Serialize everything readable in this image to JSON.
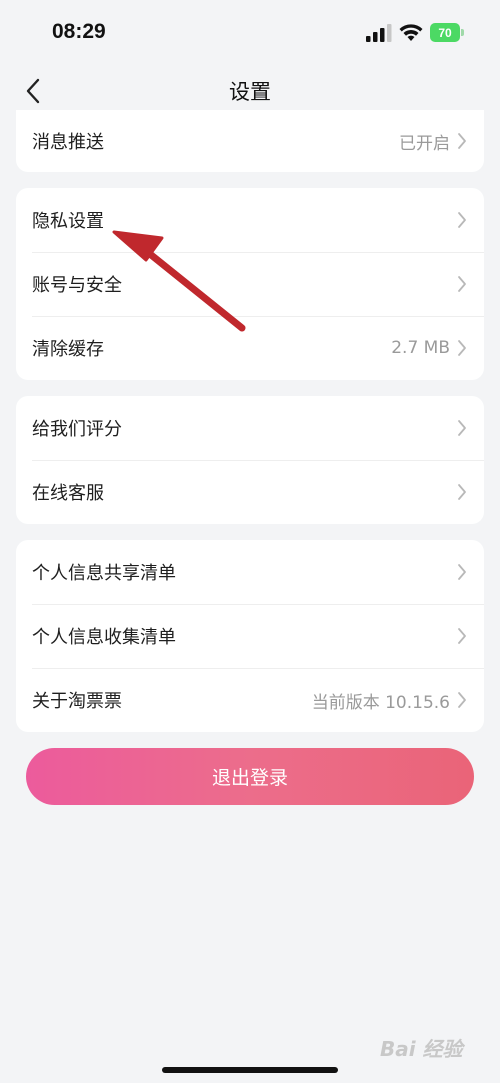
{
  "status": {
    "time": "08:29",
    "battery": "70",
    "icons": [
      "signal-icon",
      "wifi-icon",
      "battery-icon"
    ]
  },
  "nav": {
    "title": "设置",
    "back_icon": "chevron-left-icon"
  },
  "sections": [
    {
      "rows": [
        {
          "label": "消息推送",
          "value": "已开启"
        }
      ]
    },
    {
      "rows": [
        {
          "label": "隐私设置",
          "value": ""
        },
        {
          "label": "账号与安全",
          "value": ""
        },
        {
          "label": "清除缓存",
          "value": "2.7 MB"
        }
      ]
    },
    {
      "rows": [
        {
          "label": "给我们评分",
          "value": ""
        },
        {
          "label": "在线客服",
          "value": ""
        }
      ]
    },
    {
      "rows": [
        {
          "label": "个人信息共享清单",
          "value": ""
        },
        {
          "label": "个人信息收集清单",
          "value": ""
        },
        {
          "label": "关于淘票票",
          "value": "当前版本 10.15.6"
        }
      ]
    }
  ],
  "logout_label": "退出登录",
  "watermark": "Bai 经验",
  "colors": {
    "background": "#f3f4f6",
    "logout_start": "#ec5b9c",
    "logout_end": "#ea6478",
    "annotation_arrow": "#c0282d",
    "battery": "#4cd964"
  }
}
